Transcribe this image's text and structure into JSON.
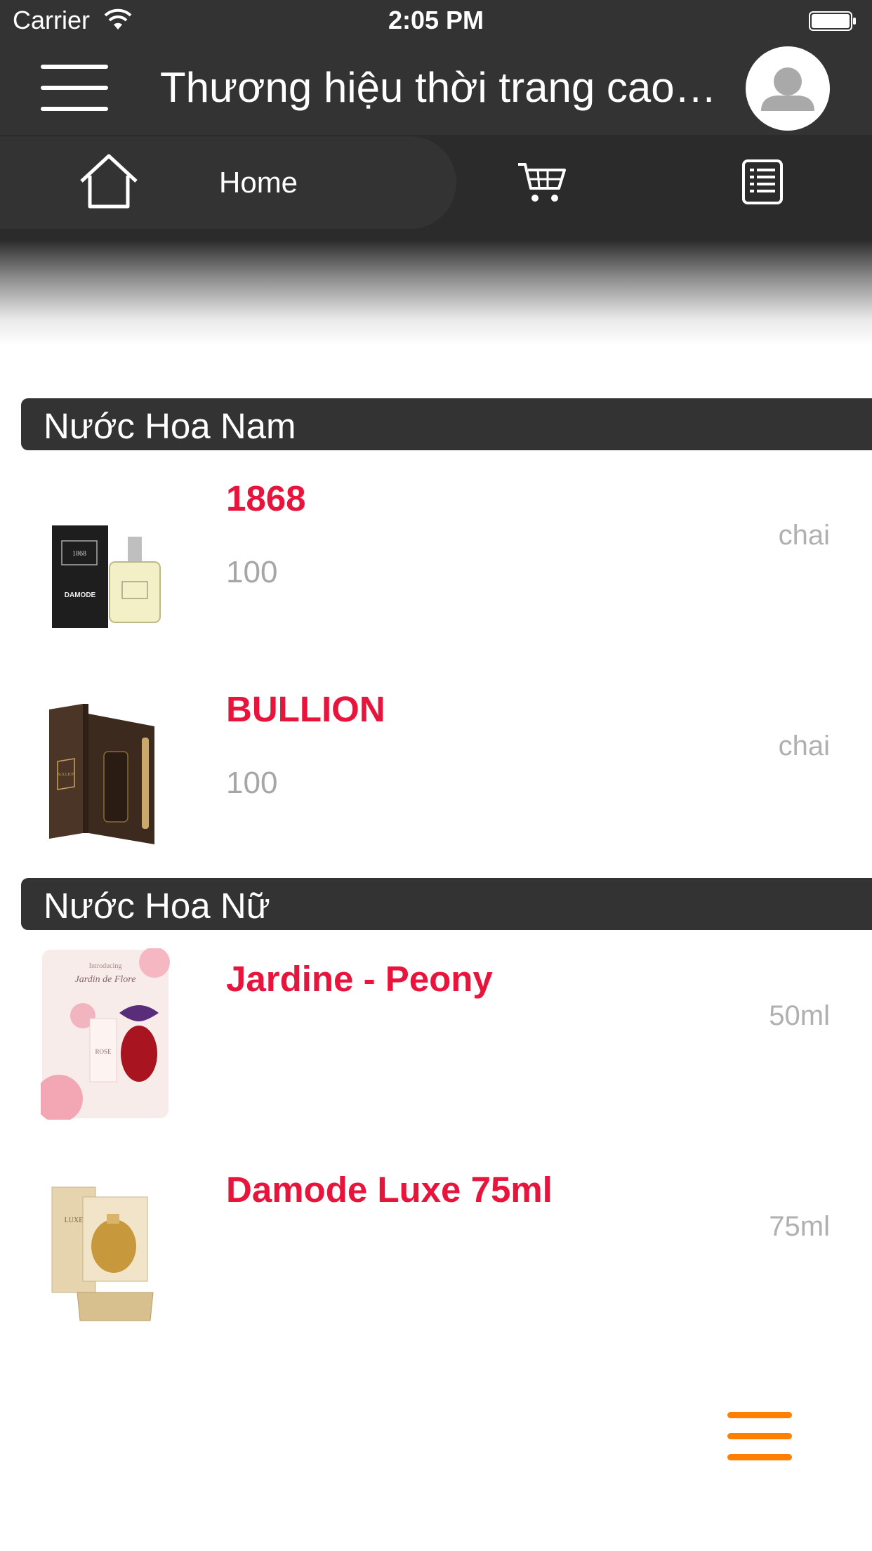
{
  "status_bar": {
    "carrier": "Carrier",
    "time": "2:05 PM"
  },
  "nav": {
    "title": "Thương hiệu thời trang cao…",
    "menu_icon": "hamburger-icon",
    "avatar_icon": "user-avatar-icon"
  },
  "tabs": {
    "home_label": "Home",
    "home_icon": "home-icon",
    "cart_icon": "cart-icon",
    "list_icon": "list-icon"
  },
  "sections": [
    {
      "title": "Nước Hoa Nam",
      "products": [
        {
          "name": "1868",
          "price": "100",
          "unit": "chai"
        },
        {
          "name": "BULLION",
          "price": "100",
          "unit": "chai"
        }
      ]
    },
    {
      "title": "Nước Hoa Nữ",
      "products": [
        {
          "name": "Jardine - Peony",
          "price": "",
          "unit": "50ml"
        },
        {
          "name": "Damode Luxe 75ml",
          "price": "",
          "unit": "75ml"
        }
      ]
    }
  ],
  "product_images": {
    "p1": {
      "box_label": "1868",
      "brand": "DAMODE"
    },
    "p2": {
      "box_label": "BULLION"
    },
    "p3": {
      "heading": "Introducing",
      "script": "Jardin de Flore",
      "bottle_label": "ROSE"
    },
    "p4": {
      "box_label": "LUXE"
    }
  },
  "colors": {
    "header_bg": "#333333",
    "product_name": "#e8143c",
    "fab": "#ff8000"
  }
}
